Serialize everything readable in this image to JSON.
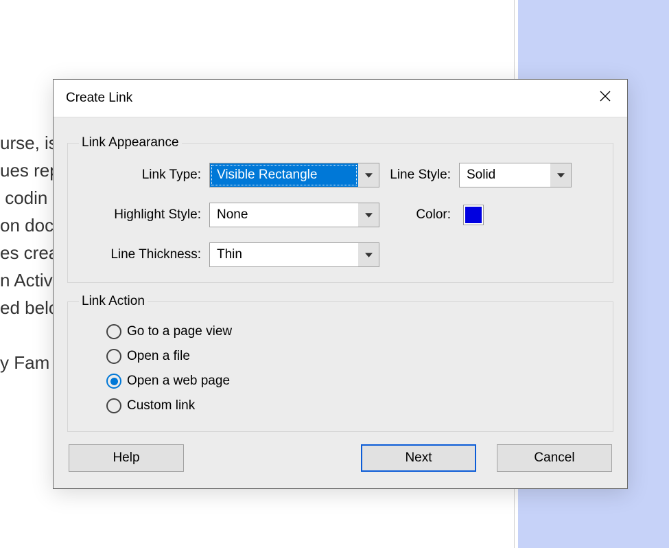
{
  "background": {
    "lines": [
      "urse, is",
      "ues rep",
      " codin",
      "on doc",
      "es crea",
      "n Activ",
      "ed belo",
      "",
      "y Fam"
    ]
  },
  "dialog": {
    "title": "Create Link",
    "appearance": {
      "legend": "Link Appearance",
      "link_type_label": "Link Type:",
      "link_type_value": "Visible Rectangle",
      "line_style_label": "Line Style:",
      "line_style_value": "Solid",
      "highlight_style_label": "Highlight Style:",
      "highlight_style_value": "None",
      "color_label": "Color:",
      "color_value": "#0000e0",
      "line_thickness_label": "Line Thickness:",
      "line_thickness_value": "Thin"
    },
    "action": {
      "legend": "Link Action",
      "options": [
        {
          "label": "Go to a page view",
          "checked": false
        },
        {
          "label": "Open a file",
          "checked": false
        },
        {
          "label": "Open a web page",
          "checked": true
        },
        {
          "label": "Custom link",
          "checked": false
        }
      ]
    },
    "buttons": {
      "help": "Help",
      "next": "Next",
      "cancel": "Cancel"
    }
  }
}
